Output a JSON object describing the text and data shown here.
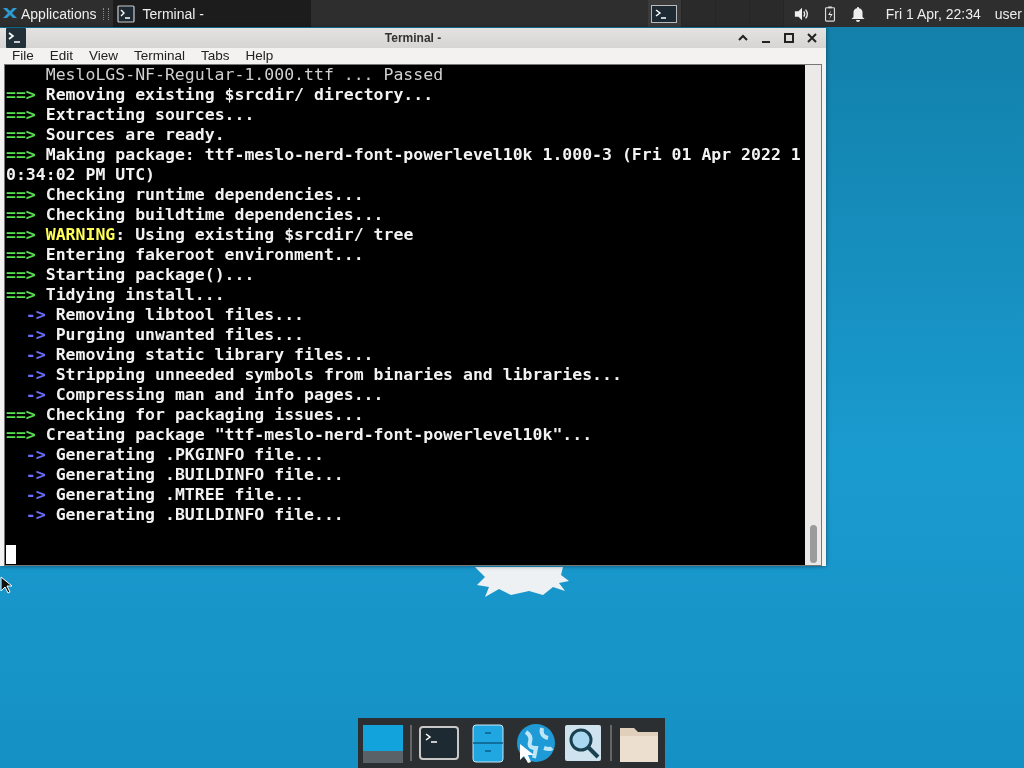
{
  "panel": {
    "menu_label": "Applications",
    "tasks": [
      {
        "title": "Terminal -",
        "selected": true
      }
    ],
    "workspaces": [
      {
        "selected": true
      },
      {
        "selected": false
      },
      {
        "selected": false
      },
      {
        "selected": false
      }
    ],
    "clock": "Fri 1 Apr, 22:34",
    "user": "user"
  },
  "window": {
    "title": "Terminal -",
    "menu": [
      "File",
      "Edit",
      "View",
      "Terminal",
      "Tabs",
      "Help"
    ],
    "lines": [
      {
        "kind": "detail",
        "text": "MesloLGS-NF-Regular-1.000.ttf ... Passed"
      },
      {
        "kind": "step",
        "prefix": "==>",
        "text": "Removing existing $srcdir/ directory..."
      },
      {
        "kind": "step",
        "prefix": "==>",
        "text": "Extracting sources..."
      },
      {
        "kind": "step",
        "prefix": "==>",
        "text": "Sources are ready."
      },
      {
        "kind": "step",
        "prefix": "==>",
        "text": "Making package: ttf-meslo-nerd-font-powerlevel10k 1.000-3 (Fri 01 Apr 2022 1"
      },
      {
        "kind": "wrap",
        "text": "0:34:02 PM UTC)"
      },
      {
        "kind": "step",
        "prefix": "==>",
        "text": "Checking runtime dependencies..."
      },
      {
        "kind": "step",
        "prefix": "==>",
        "text": "Checking buildtime dependencies..."
      },
      {
        "kind": "warning",
        "prefix": "==>",
        "label": "WARNING",
        "text": ": Using existing $srcdir/ tree"
      },
      {
        "kind": "step",
        "prefix": "==>",
        "text": "Entering fakeroot environment..."
      },
      {
        "kind": "step",
        "prefix": "==>",
        "text": "Starting package()..."
      },
      {
        "kind": "step",
        "prefix": "==>",
        "text": "Tidying install..."
      },
      {
        "kind": "sub",
        "prefix": "->",
        "text": "Removing libtool files..."
      },
      {
        "kind": "sub",
        "prefix": "->",
        "text": "Purging unwanted files..."
      },
      {
        "kind": "sub",
        "prefix": "->",
        "text": "Removing static library files..."
      },
      {
        "kind": "sub",
        "prefix": "->",
        "text": "Stripping unneeded symbols from binaries and libraries..."
      },
      {
        "kind": "sub",
        "prefix": "->",
        "text": "Compressing man and info pages..."
      },
      {
        "kind": "step",
        "prefix": "==>",
        "text": "Checking for packaging issues..."
      },
      {
        "kind": "step",
        "prefix": "==>",
        "text": "Creating package \"ttf-meslo-nerd-font-powerlevel10k\"..."
      },
      {
        "kind": "sub",
        "prefix": "->",
        "text": "Generating .PKGINFO file..."
      },
      {
        "kind": "sub",
        "prefix": "->",
        "text": "Generating .BUILDINFO file..."
      },
      {
        "kind": "sub",
        "prefix": "->",
        "text": "Generating .MTREE file..."
      },
      {
        "kind": "sub",
        "prefix": "->",
        "text": "Generating .BUILDINFO file..."
      }
    ]
  }
}
